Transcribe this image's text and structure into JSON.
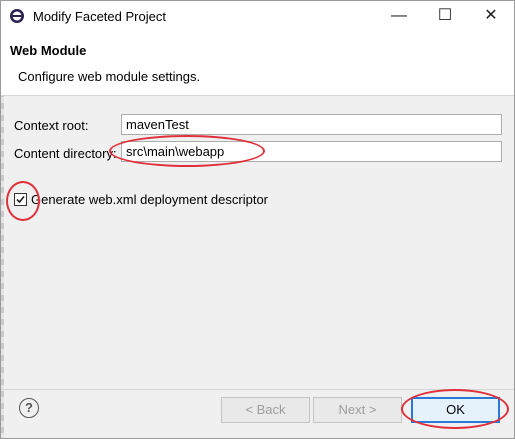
{
  "window": {
    "title": "Modify Faceted Project"
  },
  "header": {
    "title": "Web Module",
    "description": "Configure web module settings."
  },
  "form": {
    "context_root_label": "Context root:",
    "context_root_value": "mavenTest",
    "content_dir_label": "Content directory:",
    "content_dir_value": "src\\main\\webapp",
    "generate_descriptor_label": "Generate web.xml deployment descriptor",
    "generate_descriptor_checked": true
  },
  "footer": {
    "help_symbol": "?",
    "back_label": "< Back",
    "next_label": "Next >",
    "ok_label": "OK"
  },
  "window_controls": {
    "minimize": "—",
    "maximize": "☐",
    "close": "✕"
  },
  "colors": {
    "annotation": "#e0303a",
    "default_button_border": "#2b78d6"
  },
  "icons": {
    "app": "eclipse-app-icon",
    "help": "help-icon",
    "checkmark": "checkmark-icon"
  }
}
